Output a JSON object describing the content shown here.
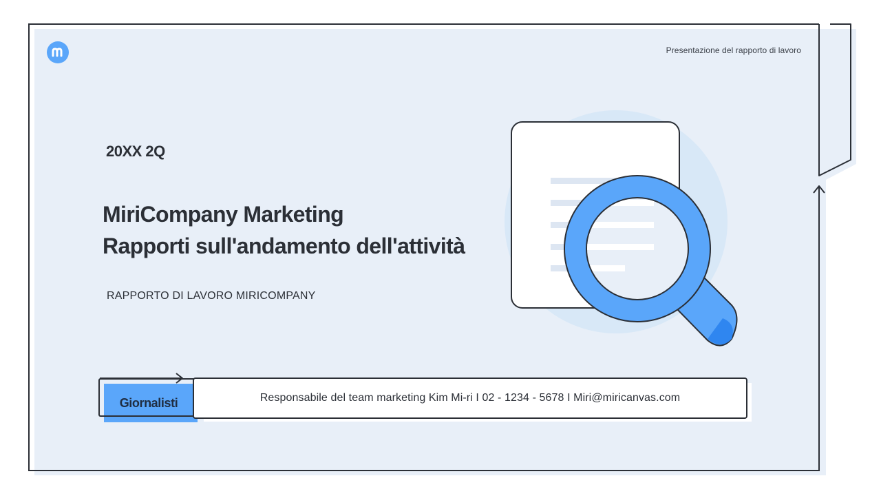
{
  "header": {
    "logo_icon": "miricanvas-m-logo",
    "note": "Presentazione del rapporto di lavoro"
  },
  "cover": {
    "period": "20XX 2Q",
    "title_line1": "MiriCompany Marketing",
    "title_line2": "Rapporti sull'andamento dell'attività",
    "subtitle": "RAPPORTO DI LAVORO MIRICOMPANY"
  },
  "footer": {
    "badge_label": "Giornalisti",
    "contact": "Responsabile del team marketing Kim Mi-ri I 02 - 1234 - 5678 I Miri@miricanvas.com"
  },
  "illustration": {
    "icon": "document-magnifier-icon"
  },
  "colors": {
    "accent": "#5aa6fa",
    "accent_dark": "#2f86f0",
    "panel_bg": "#e8eff8",
    "outline": "#2b2f36",
    "circle_bg": "#d8e8f7",
    "doc_lines": "#dde6f2"
  }
}
